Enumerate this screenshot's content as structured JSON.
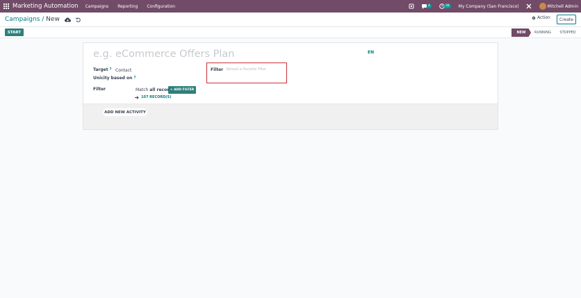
{
  "navbar": {
    "app_title": "Marketing Automation",
    "menu": [
      "Campaigns",
      "Reporting",
      "Configuration"
    ],
    "messages_count": "4",
    "activities_count": "38",
    "company": "My Company (San Francisco)",
    "user": "Mitchell Admin"
  },
  "control_panel": {
    "breadcrumb_parent": "Campaigns",
    "breadcrumb_sep": " / ",
    "breadcrumb_current": "New",
    "action_label": "Action",
    "create_label": "Create"
  },
  "statusbar": {
    "start_label": "START",
    "stages": [
      "NEW",
      "RUNNING",
      "STOPPED"
    ],
    "active_stage": "NEW"
  },
  "form": {
    "name_placeholder": "e.g. eCommerce Offers Plan",
    "lang": "EN",
    "target_label": "Target",
    "target_value": "Contact",
    "required_mark": "?",
    "unicity_label": "Unicity based on",
    "filter_label": "Filter",
    "match_prefix": "Match",
    "match_bold": "all records",
    "add_filter_label": "+ ADD FILTER",
    "records_label": "107 RECORD(S)",
    "fav_filter_label": "Filter",
    "fav_filter_placeholder": "Reload a Favorite Filter",
    "add_activity_label": "ADD NEW ACTIVITY"
  },
  "colors": {
    "brand": "#714b67",
    "accent": "#017e84",
    "primary_btn": "#2f7f7a",
    "highlight_border": "#c8303a"
  }
}
